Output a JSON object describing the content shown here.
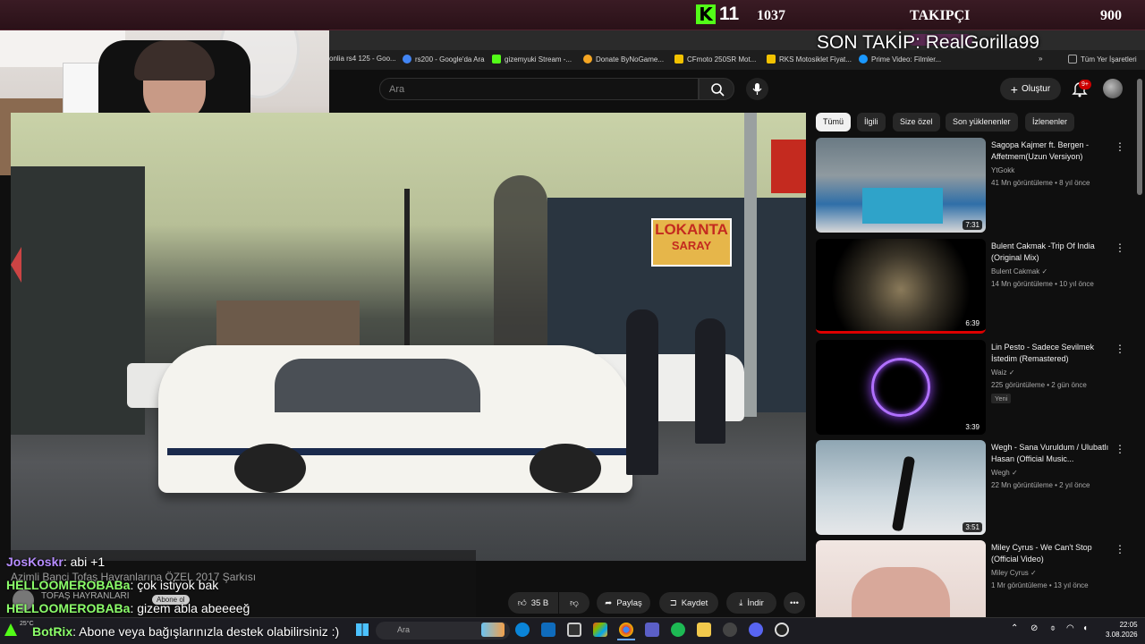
{
  "overlay": {
    "kick_count": "11",
    "followers_count": "1037",
    "followers_label": "TAKIPÇI",
    "followers_goal": "900",
    "last_follow": "SON TAKİP: RealGorilla99"
  },
  "bookmarks": [
    {
      "label": "onlia rs4 125 - Goo...",
      "color": "#4285f4"
    },
    {
      "label": "rs200 - Google'da Ara",
      "color": "#4285f4"
    },
    {
      "label": "gizemyuki Stream -...",
      "color": "#53fc18"
    },
    {
      "label": "Donate ByNoGame...",
      "color": "#f5a623"
    },
    {
      "label": "CFmoto 250SR Mot...",
      "color": "#f2c200"
    },
    {
      "label": "RKS Motosiklet Fiyat...",
      "color": "#f2c200"
    },
    {
      "label": "Prime Video: Filmler...",
      "color": "#1a98ff"
    },
    {
      "label": "Tüm Yer İşaretleri",
      "color": "#aaaaaa"
    }
  ],
  "header": {
    "search_placeholder": "Ara",
    "create_label": "Oluştur",
    "notifications": "9+"
  },
  "video": {
    "sign_lokanta": "LOKANTA",
    "sign_saray": "SARAY",
    "title_ghost": "Azimli Banci Tofaş Hayranlarına ÖZEL 2017 Şarkısı",
    "channel_ghost": "TOFAŞ HAYRANLARI",
    "subscribe_ghost": "Abone ol",
    "likes": "35 B",
    "share": "Paylaş",
    "save": "Kaydet",
    "download": "İndir"
  },
  "chips": [
    "Tümü",
    "İlgili",
    "Size özel",
    "Son yüklenenler",
    "İzlenenler"
  ],
  "recommendations": [
    {
      "title": "Sagopa Kajmer ft. Bergen - Affetmem(Uzun Versiyon)",
      "channel": "YtGokk",
      "meta": "41 Mn görüntüleme • 8 yıl önce",
      "duration": "7:31",
      "badge": ""
    },
    {
      "title": "Bulent Cakmak -Trip Of India (Original Mix)",
      "channel": "Bulent Cakmak ✓",
      "meta": "14 Mn görüntüleme • 10 yıl önce",
      "duration": "6:39",
      "badge": ""
    },
    {
      "title": "Lin Pesto - Sadece Sevilmek İstedim (Remastered)",
      "channel": "Waiz ✓",
      "meta": "225 görüntüleme • 2 gün önce",
      "duration": "3:39",
      "badge": "Yeni"
    },
    {
      "title": "Wegh - Sana Vuruldum / Ulubatlı Hasan (Official Music...",
      "channel": "Wegh ✓",
      "meta": "22 Mn görüntüleme • 2 yıl önce",
      "duration": "3:51",
      "badge": ""
    },
    {
      "title": "Miley Cyrus - We Can't Stop (Official Video)",
      "channel": "Miley Cyrus ✓",
      "meta": "1 Mr görüntüleme • 13 yıl önce",
      "duration": "",
      "badge": ""
    }
  ],
  "chat": [
    {
      "user": "JosKoskr",
      "color": "#b68cff",
      "message": ": abi +1"
    },
    {
      "user": "HELLOOMEROBABa",
      "color": "#8cff6a",
      "message": ": çok istiyok bak"
    },
    {
      "user": "HELLOOMEROBABa",
      "color": "#8cff6a",
      "message": ": gizem abla abeeeeğ"
    },
    {
      "user": "BotRix",
      "color": "#8cff6a",
      "message": ": Abone veya bağışlarınızla destek olabilirsiniz :)"
    }
  ],
  "taskbar": {
    "search_placeholder": "Ara",
    "time": "22:05",
    "date": "3.08.2026",
    "temp": "25°C"
  }
}
